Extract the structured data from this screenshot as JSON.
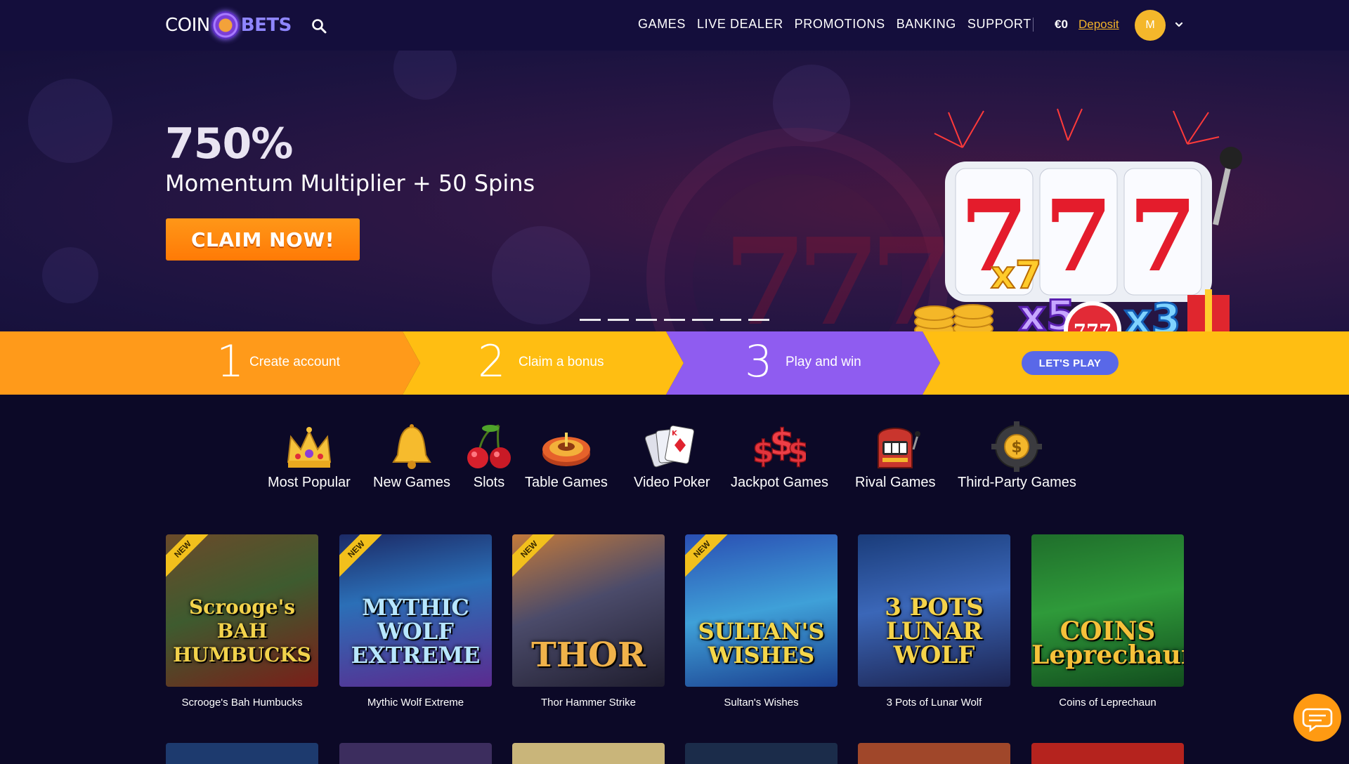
{
  "header": {
    "logo": {
      "left": "COIN",
      "right": "BETS"
    },
    "nav": [
      "GAMES",
      "LIVE DEALER",
      "PROMOTIONS",
      "BANKING",
      "SUPPORT"
    ],
    "balance": "€0",
    "deposit_label": "Deposit",
    "avatar_initial": "M"
  },
  "hero": {
    "headline": "750%",
    "subline": "Momentum Multiplier + 50 Spins",
    "cta_label": "CLAIM NOW!",
    "slide_count": 7
  },
  "steps": [
    {
      "number": "1",
      "label": "Create account"
    },
    {
      "number": "2",
      "label": "Claim a bonus"
    },
    {
      "number": "3",
      "label": "Play and win"
    }
  ],
  "steps_cta": "LET'S PLAY",
  "categories": [
    {
      "label": "Most Popular",
      "icon": "crown-icon"
    },
    {
      "label": "New Games",
      "icon": "bell-icon"
    },
    {
      "label": "Slots",
      "icon": "cherries-icon"
    },
    {
      "label": "Table Games",
      "icon": "roulette-icon"
    },
    {
      "label": "Video Poker",
      "icon": "playing-cards-icon"
    },
    {
      "label": "Jackpot Games",
      "icon": "dollar-signs-icon"
    },
    {
      "label": "Rival Games",
      "icon": "slot-machine-icon"
    },
    {
      "label": "Third-Party Games",
      "icon": "gear-coin-icon"
    }
  ],
  "games": [
    {
      "name": "Scrooge's Bah Humbucks",
      "art_title": "Scrooge's BAH HUMBUCKS",
      "badge": "NEW"
    },
    {
      "name": "Mythic Wolf Extreme",
      "art_title": "MYTHIC WOLF EXTREME",
      "badge": "NEW"
    },
    {
      "name": "Thor Hammer Strike",
      "art_title": "THOR",
      "badge": "NEW"
    },
    {
      "name": "Sultan's Wishes",
      "art_title": "SULTAN'S WISHES",
      "badge": "NEW"
    },
    {
      "name": "3 Pots of Lunar Wolf",
      "art_title": "3 POTS LUNAR WOLF",
      "badge": ""
    },
    {
      "name": "Coins of Leprechaun",
      "art_title": "COINS Leprechaun",
      "badge": ""
    }
  ],
  "colors": {
    "nav_bg": "#140e3c",
    "page_bg": "#0c0927",
    "cta_orange": "#ff8a0f",
    "deposit_gold": "#f3b429",
    "step_orange": "#ff9a1a",
    "step_yellow": "#ffbe12",
    "step_purple": "#8f5cf0",
    "lets_play_blue": "#5968e8"
  }
}
